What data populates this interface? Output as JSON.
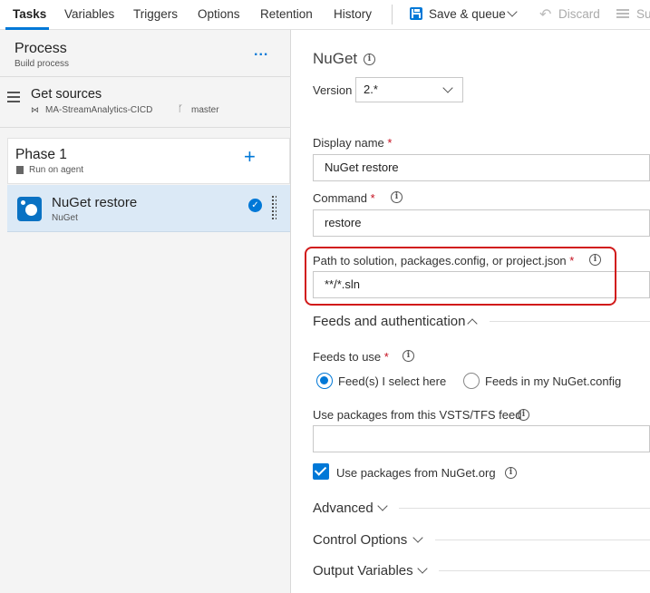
{
  "tabs": [
    {
      "label": "Tasks",
      "active": true
    },
    {
      "label": "Variables"
    },
    {
      "label": "Triggers"
    },
    {
      "label": "Options"
    },
    {
      "label": "Retention"
    },
    {
      "label": "History"
    }
  ],
  "toolbar": {
    "save_queue": "Save & queue",
    "discard": "Discard",
    "summary": "Su"
  },
  "process": {
    "title": "Process",
    "subtitle": "Build process",
    "more": "..."
  },
  "get_sources": {
    "title": "Get sources",
    "repo": "MA-StreamAnalytics-CICD",
    "branch": "master"
  },
  "phase": {
    "title": "Phase 1",
    "subtitle": "Run on agent"
  },
  "task": {
    "title": "NuGet restore",
    "subtitle": "NuGet"
  },
  "detail": {
    "title": "NuGet",
    "version_label": "Version",
    "version_value": "2.*",
    "display_name_label": "Display name",
    "display_name_value": "NuGet restore",
    "command_label": "Command",
    "command_value": "restore",
    "path_label": "Path to solution, packages.config, or project.json",
    "path_value": "**/*.sln",
    "required_marker": "*",
    "feeds_section": "Feeds and authentication",
    "feeds_to_use_label": "Feeds to use",
    "feeds_option_1": "Feed(s) I select here",
    "feeds_option_2": "Feeds in my NuGet.config",
    "feeds_selected": "Feed(s) I select here",
    "vsts_feed_label": "Use packages from this VSTS/TFS feed",
    "vsts_feed_value": "",
    "nuget_org_label": "Use packages from NuGet.org",
    "nuget_org_checked": true,
    "advanced_section": "Advanced",
    "control_options_section": "Control Options",
    "output_variables_section": "Output Variables"
  },
  "colors": {
    "accent": "#0078d7",
    "highlight_border": "#d11a1a",
    "selected_task_bg": "#dbe9f6"
  }
}
